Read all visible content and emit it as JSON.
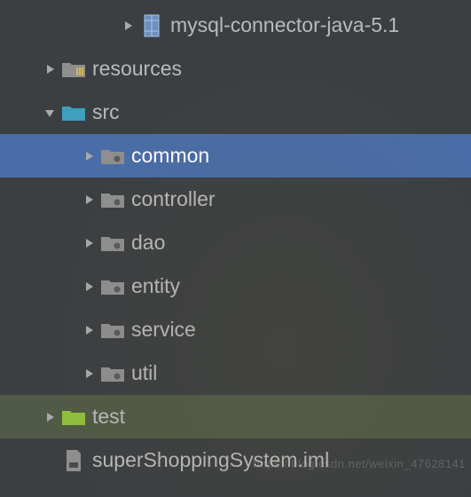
{
  "tree": {
    "items": [
      {
        "label": "mysql-connector-java-5.1",
        "icon": "jar",
        "expandable": true,
        "expanded": false,
        "indent": 3,
        "selected": false,
        "highlighted": false
      },
      {
        "label": "resources",
        "icon": "folder-resources",
        "expandable": true,
        "expanded": false,
        "indent": 1,
        "selected": false,
        "highlighted": false
      },
      {
        "label": "src",
        "icon": "folder-src",
        "expandable": true,
        "expanded": true,
        "indent": 1,
        "selected": false,
        "highlighted": false
      },
      {
        "label": "common",
        "icon": "package",
        "expandable": true,
        "expanded": false,
        "indent": 2,
        "selected": true,
        "highlighted": false
      },
      {
        "label": "controller",
        "icon": "package",
        "expandable": true,
        "expanded": false,
        "indent": 2,
        "selected": false,
        "highlighted": false
      },
      {
        "label": "dao",
        "icon": "package",
        "expandable": true,
        "expanded": false,
        "indent": 2,
        "selected": false,
        "highlighted": false
      },
      {
        "label": "entity",
        "icon": "package",
        "expandable": true,
        "expanded": false,
        "indent": 2,
        "selected": false,
        "highlighted": false
      },
      {
        "label": "service",
        "icon": "package",
        "expandable": true,
        "expanded": false,
        "indent": 2,
        "selected": false,
        "highlighted": false
      },
      {
        "label": "util",
        "icon": "package",
        "expandable": true,
        "expanded": false,
        "indent": 2,
        "selected": false,
        "highlighted": false
      },
      {
        "label": "test",
        "icon": "folder-test",
        "expandable": true,
        "expanded": false,
        "indent": 1,
        "selected": false,
        "highlighted": true
      },
      {
        "label": "superShoppingSystem.iml",
        "icon": "iml",
        "expandable": false,
        "expanded": false,
        "indent": 1,
        "selected": false,
        "highlighted": false
      }
    ]
  },
  "watermark": "https://blog.csdn.net/weixin_47628141",
  "colors": {
    "folder_src": "#3e9fbf",
    "folder_test": "#8fbf3e",
    "folder_resources_bars": "#d8b74a",
    "package": "#8f8f8f",
    "jar_body": "#6e8fbf",
    "iml": "#8f8f8f"
  }
}
